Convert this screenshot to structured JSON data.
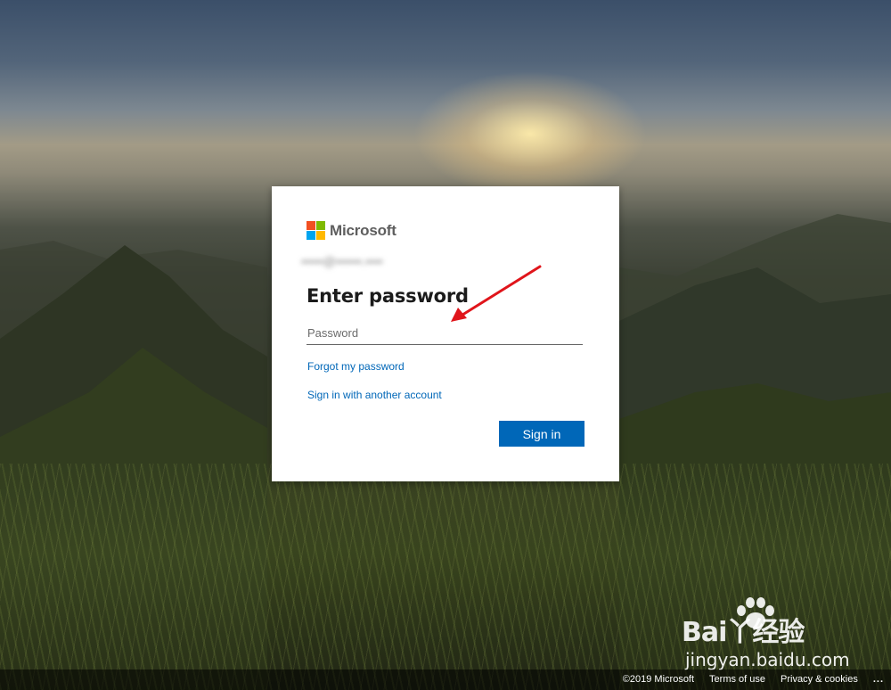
{
  "brand": {
    "name": "Microsoft",
    "logo_colors": [
      "#f25022",
      "#7fba00",
      "#00a4ef",
      "#ffb900"
    ]
  },
  "login": {
    "identity_email": "•••••@••••••.••••",
    "title": "Enter password",
    "password_placeholder": "Password",
    "forgot_link": "Forgot my password",
    "other_account_link": "Sign in with another account",
    "signin_button": "Sign in",
    "accent_color": "#0067b8"
  },
  "footer": {
    "copyright": "©2019 Microsoft",
    "terms": "Terms of use",
    "privacy": "Privacy & cookies",
    "more": "..."
  },
  "watermark": {
    "logo_text": "Bai丫经验",
    "url": "jingyan.baidu.com"
  }
}
